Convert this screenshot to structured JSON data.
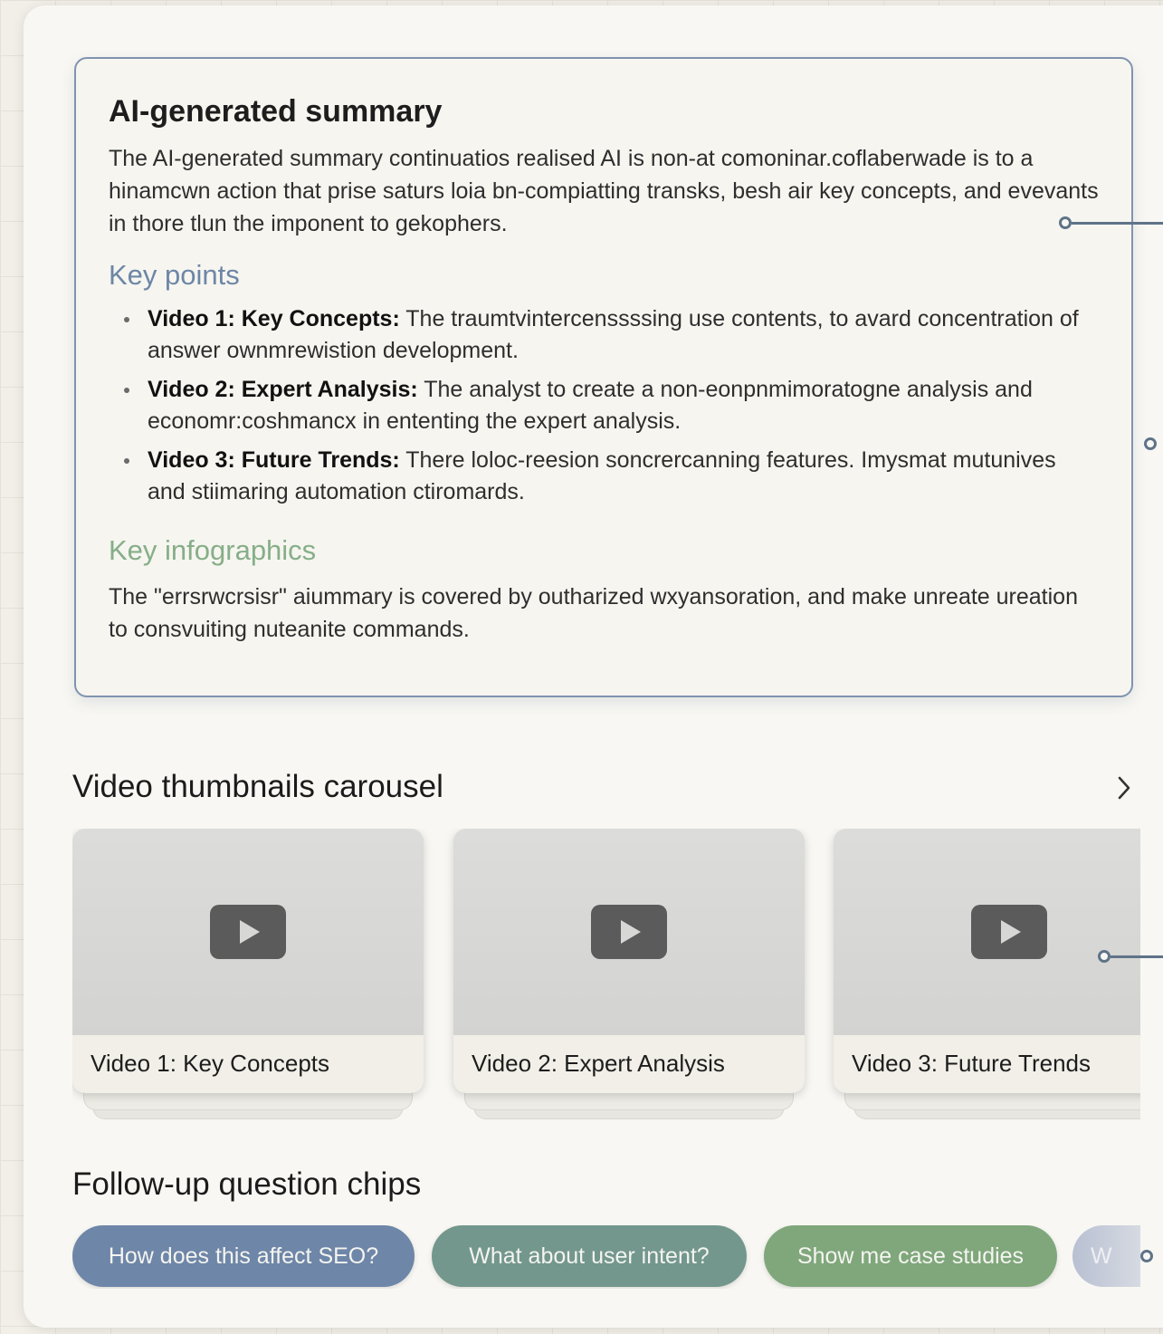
{
  "summary": {
    "title": "AI-generated summary",
    "text": "The AI-generated summary continuatios realised AI is non-at comoninar.coflaberwade is to a hinamcwn action that prise saturs loia bn-compiatting transks, besh air key concepts, and evevants in thore tlun the imponent to gekophers.",
    "key_points_heading": "Key points",
    "key_points": [
      {
        "label": "Video 1: Key Concepts:",
        "text": " The traumtvintercenssssing use contents, to avard concentration of answer ownmrewistion development."
      },
      {
        "label": "Video 2: Expert Analysis:",
        "text": " The analyst to create a non-eonpnmimoratogne analysis and economr:coshmancx in ententing the expert analysis."
      },
      {
        "label": "Video 3: Future Trends:",
        "text": " There loloc-reesion soncrercanning features. Imysmat mutunives and stiimaring automation ctiromards."
      }
    ],
    "infographics_heading": "Key infographics",
    "infographics_text": "The \"errsrwcrsisr\" aiummary is covered by outharized wxyansoration, and make unreate ureation to consvuiting nuteanite commands."
  },
  "carousel": {
    "title": "Video thumbnails carousel",
    "next_icon": "chevron-right-icon",
    "videos": [
      {
        "caption": "Video 1: Key Concepts",
        "icon": "play-icon"
      },
      {
        "caption": "Video 2: Expert Analysis",
        "icon": "play-icon"
      },
      {
        "caption": "Video 3: Future Trends",
        "icon": "play-icon"
      }
    ]
  },
  "chips": {
    "title": "Follow-up question chips",
    "items": [
      {
        "label": "How does this affect SEO?",
        "color": "#6e86a8"
      },
      {
        "label": "What about user intent?",
        "color": "#73978d"
      },
      {
        "label": "Show me case studies",
        "color": "#7fa77b"
      },
      {
        "label": "W",
        "color": "#b8c0d2"
      }
    ]
  },
  "colors": {
    "accent_blue": "#6d86a6",
    "accent_green": "#86ae88",
    "card_border": "#8094b0",
    "connector": "#5f7388"
  }
}
